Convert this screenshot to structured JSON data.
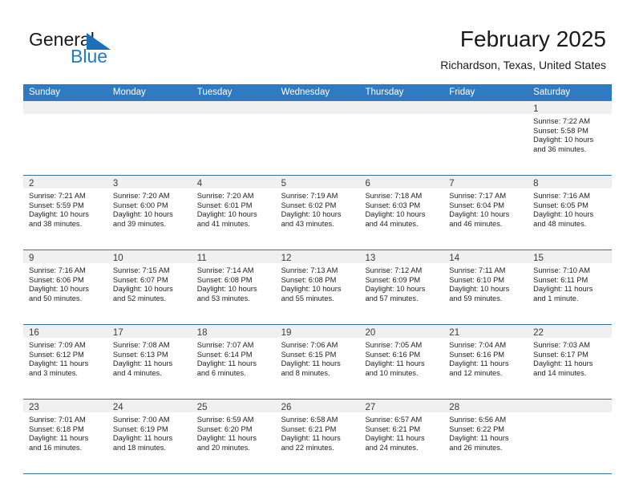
{
  "brand": {
    "name_part1": "General",
    "name_part2": "Blue",
    "logo_icon": "blue-triangle-flag-icon"
  },
  "header": {
    "month_title": "February 2025",
    "location": "Richardson, Texas, United States"
  },
  "colors": {
    "header_blue": "#2f7ac0",
    "row_divider_blue": "#3273ad",
    "daynum_band": "#f0f0f0",
    "brand_blue": "#1d7cc4",
    "text": "#222222"
  },
  "weekdays": [
    "Sunday",
    "Monday",
    "Tuesday",
    "Wednesday",
    "Thursday",
    "Friday",
    "Saturday"
  ],
  "weeks": [
    [
      {
        "day": "",
        "empty": true
      },
      {
        "day": "",
        "empty": true
      },
      {
        "day": "",
        "empty": true
      },
      {
        "day": "",
        "empty": true
      },
      {
        "day": "",
        "empty": true
      },
      {
        "day": "",
        "empty": true
      },
      {
        "day": "1",
        "sunrise": "Sunrise: 7:22 AM",
        "sunset": "Sunset: 5:58 PM",
        "daylight": "Daylight: 10 hours and 36 minutes."
      }
    ],
    [
      {
        "day": "2",
        "sunrise": "Sunrise: 7:21 AM",
        "sunset": "Sunset: 5:59 PM",
        "daylight": "Daylight: 10 hours and 38 minutes."
      },
      {
        "day": "3",
        "sunrise": "Sunrise: 7:20 AM",
        "sunset": "Sunset: 6:00 PM",
        "daylight": "Daylight: 10 hours and 39 minutes."
      },
      {
        "day": "4",
        "sunrise": "Sunrise: 7:20 AM",
        "sunset": "Sunset: 6:01 PM",
        "daylight": "Daylight: 10 hours and 41 minutes."
      },
      {
        "day": "5",
        "sunrise": "Sunrise: 7:19 AM",
        "sunset": "Sunset: 6:02 PM",
        "daylight": "Daylight: 10 hours and 43 minutes."
      },
      {
        "day": "6",
        "sunrise": "Sunrise: 7:18 AM",
        "sunset": "Sunset: 6:03 PM",
        "daylight": "Daylight: 10 hours and 44 minutes."
      },
      {
        "day": "7",
        "sunrise": "Sunrise: 7:17 AM",
        "sunset": "Sunset: 6:04 PM",
        "daylight": "Daylight: 10 hours and 46 minutes."
      },
      {
        "day": "8",
        "sunrise": "Sunrise: 7:16 AM",
        "sunset": "Sunset: 6:05 PM",
        "daylight": "Daylight: 10 hours and 48 minutes."
      }
    ],
    [
      {
        "day": "9",
        "sunrise": "Sunrise: 7:16 AM",
        "sunset": "Sunset: 6:06 PM",
        "daylight": "Daylight: 10 hours and 50 minutes."
      },
      {
        "day": "10",
        "sunrise": "Sunrise: 7:15 AM",
        "sunset": "Sunset: 6:07 PM",
        "daylight": "Daylight: 10 hours and 52 minutes."
      },
      {
        "day": "11",
        "sunrise": "Sunrise: 7:14 AM",
        "sunset": "Sunset: 6:08 PM",
        "daylight": "Daylight: 10 hours and 53 minutes."
      },
      {
        "day": "12",
        "sunrise": "Sunrise: 7:13 AM",
        "sunset": "Sunset: 6:08 PM",
        "daylight": "Daylight: 10 hours and 55 minutes."
      },
      {
        "day": "13",
        "sunrise": "Sunrise: 7:12 AM",
        "sunset": "Sunset: 6:09 PM",
        "daylight": "Daylight: 10 hours and 57 minutes."
      },
      {
        "day": "14",
        "sunrise": "Sunrise: 7:11 AM",
        "sunset": "Sunset: 6:10 PM",
        "daylight": "Daylight: 10 hours and 59 minutes."
      },
      {
        "day": "15",
        "sunrise": "Sunrise: 7:10 AM",
        "sunset": "Sunset: 6:11 PM",
        "daylight": "Daylight: 11 hours and 1 minute."
      }
    ],
    [
      {
        "day": "16",
        "sunrise": "Sunrise: 7:09 AM",
        "sunset": "Sunset: 6:12 PM",
        "daylight": "Daylight: 11 hours and 3 minutes."
      },
      {
        "day": "17",
        "sunrise": "Sunrise: 7:08 AM",
        "sunset": "Sunset: 6:13 PM",
        "daylight": "Daylight: 11 hours and 4 minutes."
      },
      {
        "day": "18",
        "sunrise": "Sunrise: 7:07 AM",
        "sunset": "Sunset: 6:14 PM",
        "daylight": "Daylight: 11 hours and 6 minutes."
      },
      {
        "day": "19",
        "sunrise": "Sunrise: 7:06 AM",
        "sunset": "Sunset: 6:15 PM",
        "daylight": "Daylight: 11 hours and 8 minutes."
      },
      {
        "day": "20",
        "sunrise": "Sunrise: 7:05 AM",
        "sunset": "Sunset: 6:16 PM",
        "daylight": "Daylight: 11 hours and 10 minutes."
      },
      {
        "day": "21",
        "sunrise": "Sunrise: 7:04 AM",
        "sunset": "Sunset: 6:16 PM",
        "daylight": "Daylight: 11 hours and 12 minutes."
      },
      {
        "day": "22",
        "sunrise": "Sunrise: 7:03 AM",
        "sunset": "Sunset: 6:17 PM",
        "daylight": "Daylight: 11 hours and 14 minutes."
      }
    ],
    [
      {
        "day": "23",
        "sunrise": "Sunrise: 7:01 AM",
        "sunset": "Sunset: 6:18 PM",
        "daylight": "Daylight: 11 hours and 16 minutes."
      },
      {
        "day": "24",
        "sunrise": "Sunrise: 7:00 AM",
        "sunset": "Sunset: 6:19 PM",
        "daylight": "Daylight: 11 hours and 18 minutes."
      },
      {
        "day": "25",
        "sunrise": "Sunrise: 6:59 AM",
        "sunset": "Sunset: 6:20 PM",
        "daylight": "Daylight: 11 hours and 20 minutes."
      },
      {
        "day": "26",
        "sunrise": "Sunrise: 6:58 AM",
        "sunset": "Sunset: 6:21 PM",
        "daylight": "Daylight: 11 hours and 22 minutes."
      },
      {
        "day": "27",
        "sunrise": "Sunrise: 6:57 AM",
        "sunset": "Sunset: 6:21 PM",
        "daylight": "Daylight: 11 hours and 24 minutes."
      },
      {
        "day": "28",
        "sunrise": "Sunrise: 6:56 AM",
        "sunset": "Sunset: 6:22 PM",
        "daylight": "Daylight: 11 hours and 26 minutes."
      },
      {
        "day": "",
        "empty": true
      }
    ]
  ]
}
